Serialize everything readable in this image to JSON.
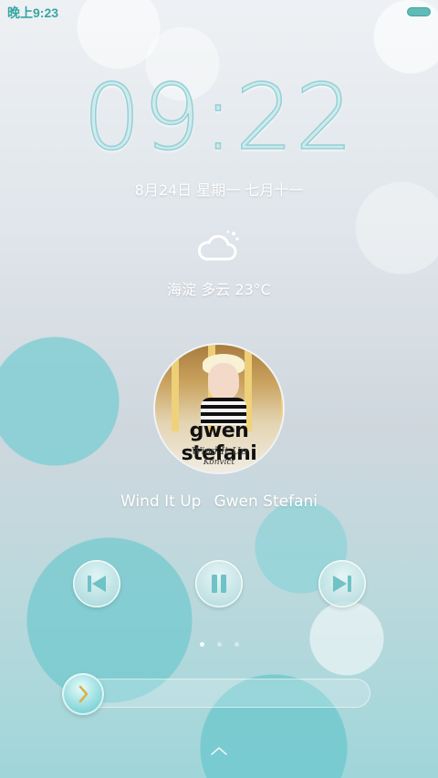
{
  "status_bar": {
    "time": "晚上9:23",
    "battery_icon": "battery-icon"
  },
  "lock_screen": {
    "clock": "09:22",
    "date": "8月24日 星期一  七月十一",
    "weather": {
      "icon": "cloud-sun-icon",
      "text": "海淀 多云 23°C"
    }
  },
  "music": {
    "album_art": {
      "artist_logo": "gwen stefani",
      "script_text": "Wind It Up",
      "sub_text": "Konvict"
    },
    "song_title": "Wind It Up",
    "artist": "Gwen Stefani",
    "controls": {
      "previous_icon": "skip-previous-icon",
      "play_pause_icon": "pause-icon",
      "next_icon": "skip-next-icon"
    }
  },
  "pager": {
    "count": 3,
    "active_index": 0
  },
  "unlock": {
    "knob_icon": "chevron-right-icon",
    "swipe_up_icon": "chevron-up-icon"
  },
  "colors": {
    "accent": "#37a7a2",
    "knob": "#7fd3d6"
  }
}
